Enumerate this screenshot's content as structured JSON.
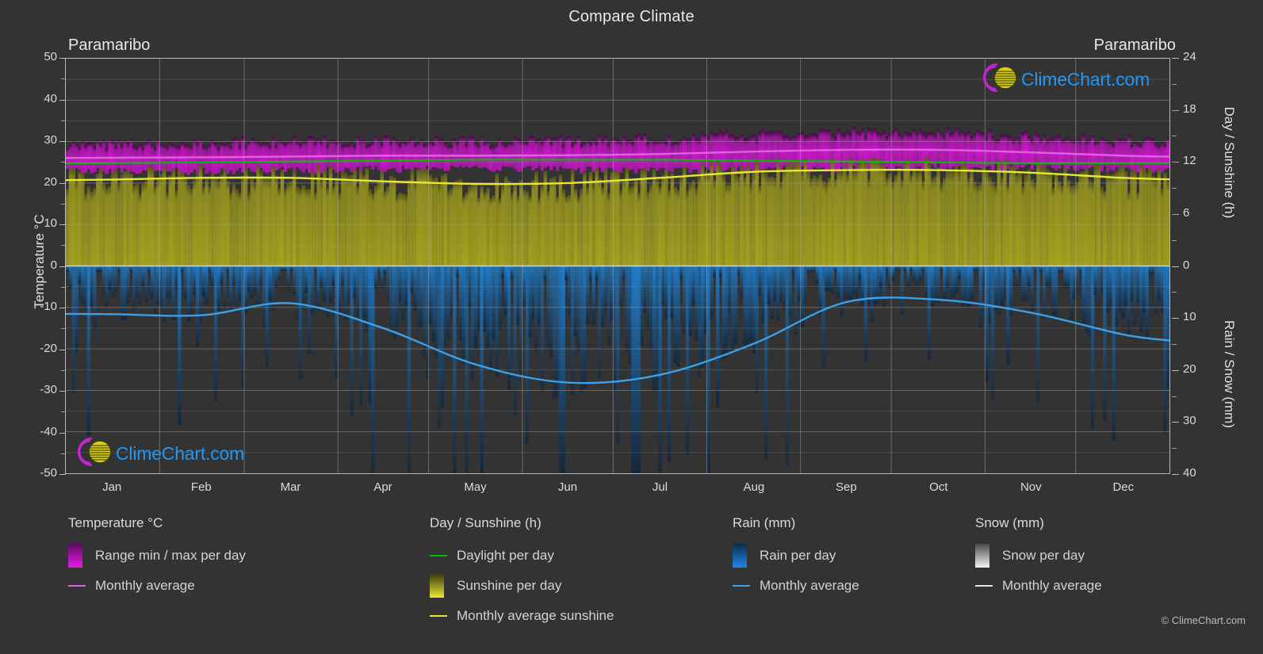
{
  "header": {
    "title": "Compare Climate",
    "city_left": "Paramaribo",
    "city_right": "Paramaribo"
  },
  "brand": {
    "name": "ClimeChart.com",
    "copyright": "© ClimeChart.com",
    "text_color": "#2196f3",
    "arc_color": "#c026d3",
    "globe_color": "#c6bd1a"
  },
  "axes": {
    "left_title": "Temperature °C",
    "right_title_top": "Day / Sunshine (h)",
    "right_title_bottom": "Rain / Snow (mm)",
    "left_ticks": [
      "50",
      "40",
      "30",
      "20",
      "10",
      "0",
      "-10",
      "-20",
      "-30",
      "-40",
      "-50"
    ],
    "right_ticks_top": [
      "24",
      "18",
      "12",
      "6",
      "0"
    ],
    "right_ticks_bottom": [
      "10",
      "20",
      "30",
      "40"
    ]
  },
  "legend": {
    "groups": [
      {
        "title": "Temperature °C",
        "items": [
          {
            "label": "Range min / max per day",
            "swatch": "gradient-box",
            "color": "#e619e6",
            "color2": "#5c0a5c"
          },
          {
            "label": "Monthly average",
            "swatch": "line",
            "color": "#e060e0"
          }
        ]
      },
      {
        "title": "Day / Sunshine (h)",
        "items": [
          {
            "label": "Daylight per day",
            "swatch": "line",
            "color": "#00c000"
          },
          {
            "label": "Sunshine per day",
            "swatch": "gradient-box",
            "color": "#e8e832",
            "color2": "#3a3a10"
          },
          {
            "label": "Monthly average sunshine",
            "swatch": "line",
            "color": "#e8e832"
          }
        ]
      },
      {
        "title": "Rain (mm)",
        "items": [
          {
            "label": "Rain per day",
            "swatch": "gradient-box",
            "color": "#1e88e5",
            "color2": "#0b2d4d"
          },
          {
            "label": "Monthly average",
            "swatch": "line",
            "color": "#3aa0e8"
          }
        ]
      },
      {
        "title": "Snow (mm)",
        "items": [
          {
            "label": "Snow per day",
            "swatch": "gradient-box",
            "color": "#f2f2f2",
            "color2": "#4a4a4a"
          },
          {
            "label": "Monthly average",
            "swatch": "line",
            "color": "#e4e4e4"
          }
        ]
      }
    ]
  },
  "chart_data": {
    "type": "line",
    "title": "Compare Climate",
    "subtitle": "Paramaribo",
    "location": "Paramaribo",
    "xlabel": "",
    "ylabel": "Temperature °C",
    "y2label_top": "Day / Sunshine (h)",
    "y2label_bottom": "Rain / Snow (mm)",
    "categories": [
      "Jan",
      "Feb",
      "Mar",
      "Apr",
      "May",
      "Jun",
      "Jul",
      "Aug",
      "Sep",
      "Oct",
      "Nov",
      "Dec"
    ],
    "ylim": [
      -50,
      50
    ],
    "y2lim_sunshine": [
      0,
      24
    ],
    "y2lim_rain": [
      0,
      40
    ],
    "grid": true,
    "legend_position": "below",
    "series": [
      {
        "name": "Monthly average temperature",
        "unit": "°C",
        "color": "#e060e0",
        "axis": "temperature",
        "values": [
          26.1,
          26.2,
          26.4,
          26.6,
          26.6,
          26.7,
          27.0,
          27.6,
          28.0,
          28.0,
          27.4,
          26.6
        ]
      },
      {
        "name": "Range min / max per day",
        "unit": "°C",
        "color": "#e619e6",
        "axis": "temperature",
        "min_values": [
          22.8,
          22.8,
          23.0,
          23.3,
          23.4,
          23.2,
          23.1,
          23.3,
          23.5,
          23.8,
          23.7,
          23.3
        ],
        "max_values": [
          29.4,
          29.7,
          30.0,
          30.2,
          30.0,
          30.1,
          30.7,
          31.6,
          32.3,
          32.3,
          31.4,
          30.2
        ]
      },
      {
        "name": "Daylight per day",
        "unit": "h",
        "color": "#00c000",
        "axis": "sunshine",
        "values": [
          11.9,
          12.0,
          12.1,
          12.2,
          12.3,
          12.3,
          12.3,
          12.2,
          12.1,
          12.0,
          11.9,
          11.9
        ]
      },
      {
        "name": "Monthly average sunshine",
        "unit": "h",
        "color": "#e8e832",
        "axis": "sunshine",
        "values": [
          10.0,
          10.2,
          10.2,
          9.8,
          9.5,
          9.6,
          10.2,
          10.9,
          11.1,
          11.1,
          10.8,
          10.2
        ]
      },
      {
        "name": "Monthly average rain",
        "unit": "mm",
        "color": "#3aa0e8",
        "axis": "rain",
        "values": [
          9.3,
          9.5,
          7.2,
          12.0,
          19.0,
          22.5,
          21.0,
          15.0,
          7.0,
          6.5,
          9.0,
          13.2
        ]
      },
      {
        "name": "Monthly average snow",
        "unit": "mm",
        "color": "#e4e4e4",
        "axis": "snow",
        "values": [
          0,
          0,
          0,
          0,
          0,
          0,
          0,
          0,
          0,
          0,
          0,
          0
        ]
      }
    ]
  }
}
